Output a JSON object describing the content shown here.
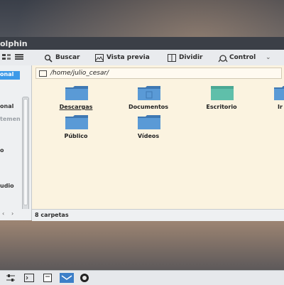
{
  "window": {
    "title": "olphin"
  },
  "toolbar": {
    "search_label": "Buscar",
    "preview_label": "Vista previa",
    "split_label": "Dividir",
    "control_label": "Control",
    "overflow": "⌄"
  },
  "sidebar": {
    "items": [
      {
        "label": "onal",
        "selected": true
      },
      {
        "label": "onal"
      },
      {
        "label": "temen"
      },
      {
        "label": "o"
      },
      {
        "label": "udio"
      }
    ],
    "nav_prev": "‹",
    "nav_next": "›"
  },
  "location": {
    "path": "/home/julio_cesar/"
  },
  "files": [
    {
      "name": "Descargas",
      "icon": "downloads-folder"
    },
    {
      "name": "Documentos",
      "icon": "documents-folder"
    },
    {
      "name": "Escritorio",
      "icon": "desktop-folder"
    },
    {
      "name": "Ir",
      "icon": "images-folder"
    },
    {
      "name": "Público",
      "icon": "public-folder"
    },
    {
      "name": "Vídeos",
      "icon": "videos-folder"
    }
  ],
  "status": {
    "text": "8 carpetas"
  },
  "colors": {
    "folder": "#5a9ad6",
    "folder_tab": "#3f78b2",
    "selection": "#3d9ae8",
    "content_bg": "#fbf3e0"
  },
  "taskbar": {
    "icons": [
      "settings-sliders-icon",
      "terminal-icon",
      "file-manager-icon",
      "mail-icon",
      "browser-icon"
    ]
  }
}
